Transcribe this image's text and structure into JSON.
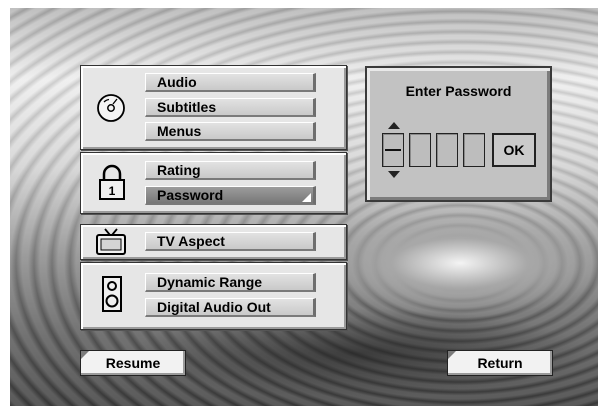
{
  "menu": {
    "groups": [
      {
        "icon": "disc-icon",
        "items": [
          "Audio",
          "Subtitles",
          "Menus"
        ]
      },
      {
        "icon": "padlock-icon",
        "items": [
          "Rating",
          "Password"
        ],
        "selected": "Password"
      },
      {
        "icon": "tv-icon",
        "items": [
          "TV Aspect"
        ]
      },
      {
        "icon": "speaker-icon",
        "items": [
          "Dynamic Range",
          "Digital Audio Out"
        ]
      }
    ]
  },
  "password_dialog": {
    "title": "Enter Password",
    "digits": [
      "",
      "",
      "",
      ""
    ],
    "ok_label": "OK"
  },
  "footer": {
    "resume_label": "Resume",
    "return_label": "Return"
  }
}
